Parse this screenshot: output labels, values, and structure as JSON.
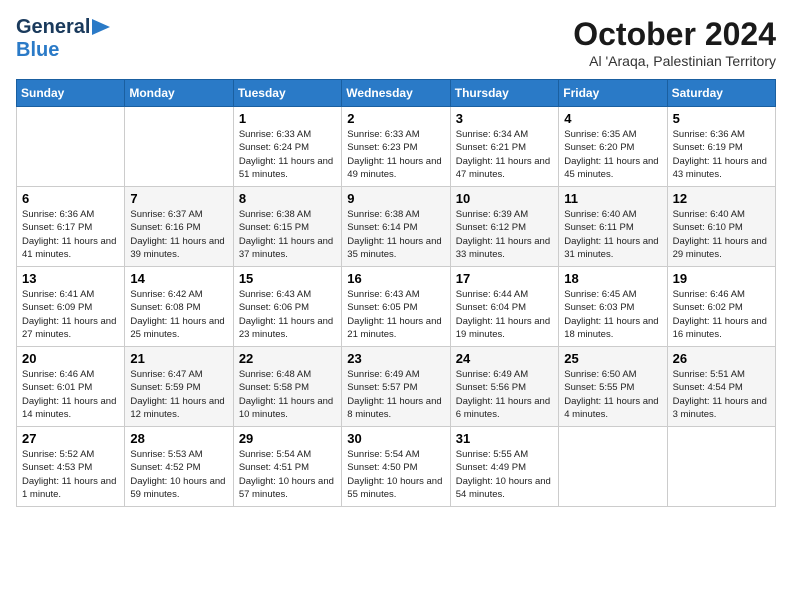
{
  "header": {
    "logo_line1": "General",
    "logo_line2": "Blue",
    "title": "October 2024",
    "subtitle": "Al 'Araqa, Palestinian Territory"
  },
  "calendar": {
    "days_of_week": [
      "Sunday",
      "Monday",
      "Tuesday",
      "Wednesday",
      "Thursday",
      "Friday",
      "Saturday"
    ],
    "weeks": [
      [
        {
          "day": "",
          "info": ""
        },
        {
          "day": "",
          "info": ""
        },
        {
          "day": "1",
          "info": "Sunrise: 6:33 AM\nSunset: 6:24 PM\nDaylight: 11 hours and 51 minutes."
        },
        {
          "day": "2",
          "info": "Sunrise: 6:33 AM\nSunset: 6:23 PM\nDaylight: 11 hours and 49 minutes."
        },
        {
          "day": "3",
          "info": "Sunrise: 6:34 AM\nSunset: 6:21 PM\nDaylight: 11 hours and 47 minutes."
        },
        {
          "day": "4",
          "info": "Sunrise: 6:35 AM\nSunset: 6:20 PM\nDaylight: 11 hours and 45 minutes."
        },
        {
          "day": "5",
          "info": "Sunrise: 6:36 AM\nSunset: 6:19 PM\nDaylight: 11 hours and 43 minutes."
        }
      ],
      [
        {
          "day": "6",
          "info": "Sunrise: 6:36 AM\nSunset: 6:17 PM\nDaylight: 11 hours and 41 minutes."
        },
        {
          "day": "7",
          "info": "Sunrise: 6:37 AM\nSunset: 6:16 PM\nDaylight: 11 hours and 39 minutes."
        },
        {
          "day": "8",
          "info": "Sunrise: 6:38 AM\nSunset: 6:15 PM\nDaylight: 11 hours and 37 minutes."
        },
        {
          "day": "9",
          "info": "Sunrise: 6:38 AM\nSunset: 6:14 PM\nDaylight: 11 hours and 35 minutes."
        },
        {
          "day": "10",
          "info": "Sunrise: 6:39 AM\nSunset: 6:12 PM\nDaylight: 11 hours and 33 minutes."
        },
        {
          "day": "11",
          "info": "Sunrise: 6:40 AM\nSunset: 6:11 PM\nDaylight: 11 hours and 31 minutes."
        },
        {
          "day": "12",
          "info": "Sunrise: 6:40 AM\nSunset: 6:10 PM\nDaylight: 11 hours and 29 minutes."
        }
      ],
      [
        {
          "day": "13",
          "info": "Sunrise: 6:41 AM\nSunset: 6:09 PM\nDaylight: 11 hours and 27 minutes."
        },
        {
          "day": "14",
          "info": "Sunrise: 6:42 AM\nSunset: 6:08 PM\nDaylight: 11 hours and 25 minutes."
        },
        {
          "day": "15",
          "info": "Sunrise: 6:43 AM\nSunset: 6:06 PM\nDaylight: 11 hours and 23 minutes."
        },
        {
          "day": "16",
          "info": "Sunrise: 6:43 AM\nSunset: 6:05 PM\nDaylight: 11 hours and 21 minutes."
        },
        {
          "day": "17",
          "info": "Sunrise: 6:44 AM\nSunset: 6:04 PM\nDaylight: 11 hours and 19 minutes."
        },
        {
          "day": "18",
          "info": "Sunrise: 6:45 AM\nSunset: 6:03 PM\nDaylight: 11 hours and 18 minutes."
        },
        {
          "day": "19",
          "info": "Sunrise: 6:46 AM\nSunset: 6:02 PM\nDaylight: 11 hours and 16 minutes."
        }
      ],
      [
        {
          "day": "20",
          "info": "Sunrise: 6:46 AM\nSunset: 6:01 PM\nDaylight: 11 hours and 14 minutes."
        },
        {
          "day": "21",
          "info": "Sunrise: 6:47 AM\nSunset: 5:59 PM\nDaylight: 11 hours and 12 minutes."
        },
        {
          "day": "22",
          "info": "Sunrise: 6:48 AM\nSunset: 5:58 PM\nDaylight: 11 hours and 10 minutes."
        },
        {
          "day": "23",
          "info": "Sunrise: 6:49 AM\nSunset: 5:57 PM\nDaylight: 11 hours and 8 minutes."
        },
        {
          "day": "24",
          "info": "Sunrise: 6:49 AM\nSunset: 5:56 PM\nDaylight: 11 hours and 6 minutes."
        },
        {
          "day": "25",
          "info": "Sunrise: 6:50 AM\nSunset: 5:55 PM\nDaylight: 11 hours and 4 minutes."
        },
        {
          "day": "26",
          "info": "Sunrise: 5:51 AM\nSunset: 4:54 PM\nDaylight: 11 hours and 3 minutes."
        }
      ],
      [
        {
          "day": "27",
          "info": "Sunrise: 5:52 AM\nSunset: 4:53 PM\nDaylight: 11 hours and 1 minute."
        },
        {
          "day": "28",
          "info": "Sunrise: 5:53 AM\nSunset: 4:52 PM\nDaylight: 10 hours and 59 minutes."
        },
        {
          "day": "29",
          "info": "Sunrise: 5:54 AM\nSunset: 4:51 PM\nDaylight: 10 hours and 57 minutes."
        },
        {
          "day": "30",
          "info": "Sunrise: 5:54 AM\nSunset: 4:50 PM\nDaylight: 10 hours and 55 minutes."
        },
        {
          "day": "31",
          "info": "Sunrise: 5:55 AM\nSunset: 4:49 PM\nDaylight: 10 hours and 54 minutes."
        },
        {
          "day": "",
          "info": ""
        },
        {
          "day": "",
          "info": ""
        }
      ]
    ]
  }
}
